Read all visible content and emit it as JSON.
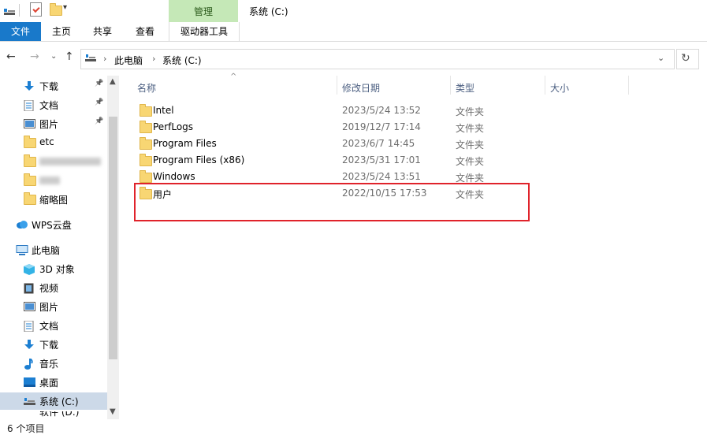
{
  "window": {
    "title": "系统 (C:)",
    "manage_tab": "管理"
  },
  "ribbon": {
    "tabs": [
      "文件",
      "主页",
      "共享",
      "查看",
      "驱动器工具"
    ]
  },
  "qat": {
    "dropdown": "▾"
  },
  "address": {
    "crumbs": [
      "此电脑",
      "系统 (C:)"
    ],
    "separator": "›",
    "chevron": "⌄",
    "refresh": "↻"
  },
  "nav_buttons": {
    "back": "←",
    "forward": "→",
    "recent": "⌄",
    "up": "↑"
  },
  "nav_pane": {
    "quick_access": [
      {
        "label": "下载",
        "icon": "download-icon",
        "pinned": true
      },
      {
        "label": "文档",
        "icon": "documents-icon",
        "pinned": true
      },
      {
        "label": "图片",
        "icon": "pictures-icon",
        "pinned": true
      },
      {
        "label": "etc",
        "icon": "folder-icon",
        "pinned": false
      },
      {
        "label": "缩略图",
        "icon": "folder-icon",
        "pinned": false
      }
    ],
    "pin_glyph": "📌",
    "wps": "WPS云盘",
    "this_pc": "此电脑",
    "pc_items": [
      {
        "label": "3D 对象",
        "icon": "3d-objects-icon"
      },
      {
        "label": "视频",
        "icon": "videos-icon"
      },
      {
        "label": "图片",
        "icon": "pictures-icon"
      },
      {
        "label": "文档",
        "icon": "documents-icon"
      },
      {
        "label": "下载",
        "icon": "download-icon"
      },
      {
        "label": "音乐",
        "icon": "music-icon"
      },
      {
        "label": "桌面",
        "icon": "desktop-icon"
      },
      {
        "label": "系统 (C:)",
        "icon": "drive-icon",
        "selected": true
      },
      {
        "label": "软件 (D:)",
        "icon": "drive-icon"
      }
    ],
    "scroll_up": "▲",
    "scroll_down": "▼"
  },
  "columns": {
    "name": "名称",
    "modified": "修改日期",
    "type": "类型",
    "size": "大小",
    "sort_glyph": "^"
  },
  "files": [
    {
      "name": "Intel",
      "modified": "2023/5/24 13:52",
      "type": "文件夹"
    },
    {
      "name": "PerfLogs",
      "modified": "2019/12/7 17:14",
      "type": "文件夹"
    },
    {
      "name": "Program Files",
      "modified": "2023/6/7 14:45",
      "type": "文件夹"
    },
    {
      "name": "Program Files (x86)",
      "modified": "2023/5/31 17:01",
      "type": "文件夹"
    },
    {
      "name": "Windows",
      "modified": "2023/5/24 13:51",
      "type": "文件夹"
    },
    {
      "name": "用户",
      "modified": "2022/10/15 17:53",
      "type": "文件夹"
    }
  ],
  "status": "6 个项目",
  "colors": {
    "accent": "#1979ca",
    "manage_tab": "#c5e8b7",
    "highlight": "#e0232b",
    "selected": "#ccd9e8"
  }
}
